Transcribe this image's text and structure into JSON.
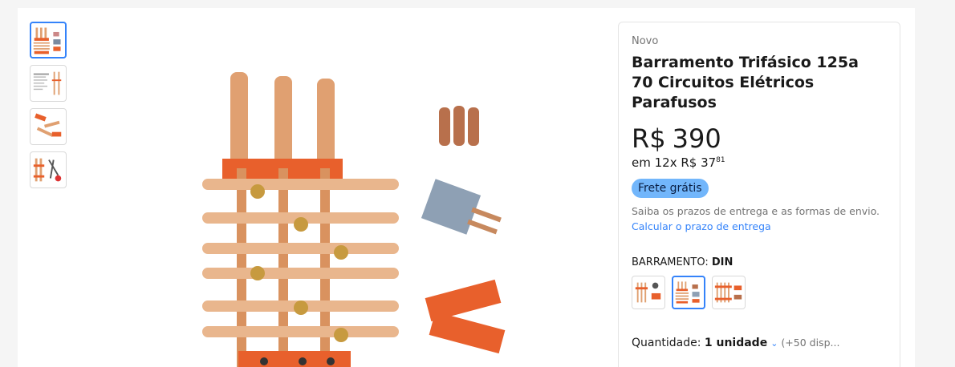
{
  "thumbnails": [
    {
      "alt": "busbar with accessories",
      "selected": true
    },
    {
      "alt": "product specification sheet",
      "selected": false
    },
    {
      "alt": "busbar components",
      "selected": false
    },
    {
      "alt": "busbar with tools",
      "selected": false
    }
  ],
  "product": {
    "condition": "Novo",
    "title": "Barramento Trifásico 125a 70 Circuitos Elétricos Parafusos",
    "price_currency": "R$",
    "price_value": "390",
    "installments_text": "em 12x R$ 37",
    "installments_cents": "81",
    "free_shipping": "Frete grátis",
    "shipping_info": "Saiba os prazos de entrega e as formas de envio.",
    "shipping_link": "Calcular o prazo de entrega",
    "variant_label": "BARRAMENTO:",
    "variant_value": "DIN",
    "variants": [
      {
        "alt": "variant 1",
        "selected": false
      },
      {
        "alt": "variant DIN",
        "selected": true
      },
      {
        "alt": "variant 3",
        "selected": false
      }
    ],
    "quantity_label": "Quantidade:",
    "quantity_value": "1 unidade",
    "quantity_available": "(+50 disp..."
  },
  "colors": {
    "accent": "#3483fa",
    "free_shipping_bg": "#72b6fb",
    "copper": "#e0a071",
    "insulator": "#e8602c"
  }
}
